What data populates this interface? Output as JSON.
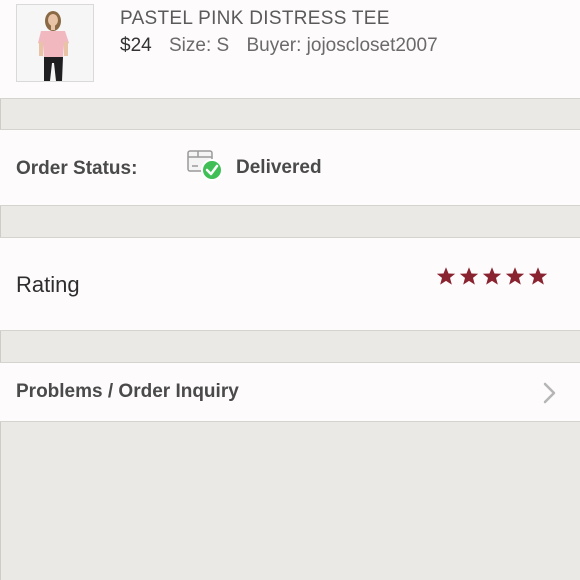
{
  "item": {
    "title": "PASTEL PINK DISTRESS TEE",
    "price": "$24",
    "size": "Size: S",
    "buyer": "Buyer: jojoscloset2007"
  },
  "order_status": {
    "label": "Order Status:",
    "value": "Delivered",
    "icon": "delivered-box-check-icon",
    "check_color": "#3fbf55"
  },
  "rating": {
    "label": "Rating",
    "stars": 5,
    "max_stars": 5,
    "star_color": "#8a2330"
  },
  "problems": {
    "label": "Problems / Order Inquiry",
    "icon": "chevron-right-icon"
  }
}
